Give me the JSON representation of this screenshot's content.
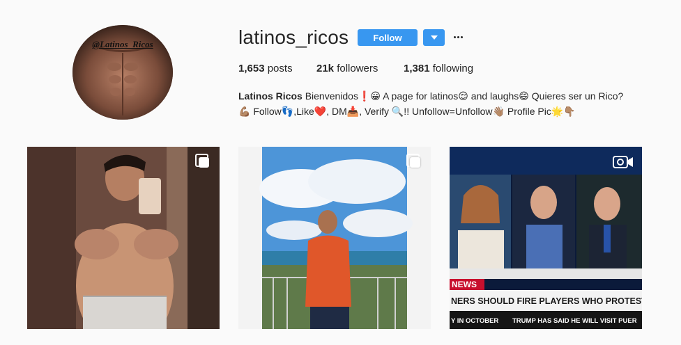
{
  "profile": {
    "username": "latinos_ricos",
    "avatar_watermark": "@Latinos_Ricos",
    "follow_label": "Follow",
    "stats": {
      "posts_count": "1,653",
      "posts_label": "posts",
      "followers_count": "21k",
      "followers_label": "followers",
      "following_count": "1,381",
      "following_label": "following"
    },
    "bio": {
      "name": "Latinos Ricos",
      "line1": "Bienvenidos❗😀 A page for latinos😌 and laughs😄 Quieres ser un Rico?",
      "line2": "💪🏽 Follow👣,Like❤️, DM📥, Verify 🔍!! Unfollow=Unfollow👋🏽 Profile Pic🌟👇🏽"
    }
  },
  "posts": [
    {
      "type": "carousel",
      "icon": "carousel-icon"
    },
    {
      "type": "carousel",
      "icon": "carousel-icon"
    },
    {
      "type": "video",
      "icon": "video-icon",
      "news_tag": "NEWS",
      "headline": "NERS SHOULD FIRE PLAYERS WHO PROTEST NATL ANTH",
      "ticker": "Y IN OCTOBER",
      "ticker2": "TRUMP HAS SAID HE WILL VISIT PUER"
    }
  ],
  "colors": {
    "accent": "#3897f0",
    "background": "#fafafa",
    "text": "#262626",
    "news_red": "#c8102e"
  }
}
